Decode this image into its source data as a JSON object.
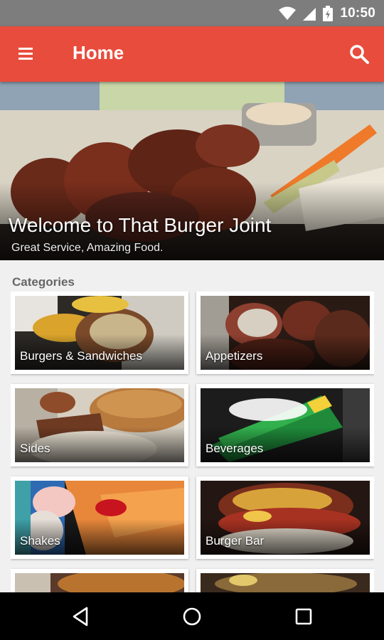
{
  "status_bar": {
    "time": "10:50",
    "icons": [
      "wifi-icon",
      "signal-icon",
      "battery-icon"
    ]
  },
  "app_bar": {
    "title": "Home",
    "menu_icon": "menu-icon",
    "search_icon": "search-icon",
    "color": "#e84c3d"
  },
  "hero": {
    "title": "Welcome to That Burger Joint",
    "subtitle": "Great Service, Amazing Food."
  },
  "categories": {
    "label": "Categories",
    "items": [
      {
        "label": "Burgers & Sandwiches"
      },
      {
        "label": "Appetizers"
      },
      {
        "label": "Sides"
      },
      {
        "label": "Beverages"
      },
      {
        "label": "Shakes"
      },
      {
        "label": "Burger Bar"
      },
      {
        "label": ""
      },
      {
        "label": ""
      }
    ]
  },
  "nav_bar": {
    "icons": [
      "back-icon",
      "home-icon",
      "recents-icon"
    ]
  }
}
